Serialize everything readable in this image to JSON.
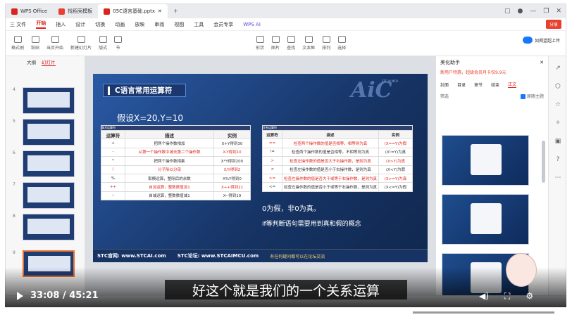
{
  "tabs": [
    {
      "label": "WPS Office",
      "color": "#d9241e"
    },
    {
      "label": "找稻壳模板",
      "color": "#e8402f"
    },
    {
      "label": "05C语言基础.pptx",
      "color": "#d9241e"
    }
  ],
  "menu": [
    "三 文件",
    "开始",
    "插入",
    "设计",
    "切换",
    "动画",
    "放映",
    "审阅",
    "视图",
    "工具",
    "会员专享",
    "WPS AI"
  ],
  "share_label": "分享",
  "ribbon": {
    "items": [
      "格式刷",
      "粘贴",
      "当页开始",
      "新建幻灯片",
      "版式",
      "节",
      "形状",
      "图片",
      "查找",
      "文本框",
      "排列",
      "选择"
    ],
    "upload_label": "如揭望超上传"
  },
  "left_panel": {
    "tabs": [
      "大纲",
      "幻灯片"
    ],
    "slide_numbers": [
      "4",
      "5",
      "6",
      "7",
      "8",
      "9"
    ]
  },
  "slide": {
    "title": "C语言常用运算符",
    "logo": "AiC",
    "logo_sub": "STC AI MCU",
    "assumption": "假设X=20,Y=10",
    "table1": {
      "caption": "算术运算符",
      "headers": [
        "运算符",
        "描述",
        "实例"
      ],
      "rows": [
        {
          "op": "+",
          "desc": "把两个操作数相加",
          "ex": "X+Y得到30",
          "red": false
        },
        {
          "op": "-",
          "desc": "从第一个操作数中减去第二个操作数",
          "ex": "X-Y得到10",
          "red": true
        },
        {
          "op": "*",
          "desc": "把两个操作数相乘",
          "ex": "X*Y得到200",
          "red": false
        },
        {
          "op": "/",
          "desc": "分子除以分母",
          "ex": "X/Y得到2",
          "red": true
        },
        {
          "op": "%",
          "desc": "取模运算，整除后的余数",
          "ex": "X%Y得到0",
          "red": false
        },
        {
          "op": "++",
          "desc": "自加运算，整数数值加1",
          "ex": "X++得到21",
          "red": true
        },
        {
          "op": "--",
          "desc": "自减运算，整数数值减1",
          "ex": "X--得到19",
          "red": false
        }
      ]
    },
    "table2": {
      "caption": "关系运算符",
      "headers": [
        "运算符",
        "描述",
        "实例"
      ],
      "rows": [
        {
          "op": "==",
          "desc": "检查两个操作数的值是否相等，相等则为真",
          "ex": "(X==Y)为假",
          "red": true
        },
        {
          "op": "!=",
          "desc": "检查两个操作数的值是否相等，不相等则为真",
          "ex": "(X!=Y)为真",
          "red": false
        },
        {
          "op": ">",
          "desc": "检查左操作数的值是否大于右操作数，是则为真",
          "ex": "(X>Y)为真",
          "red": true
        },
        {
          "op": "<",
          "desc": "检查左操作数的值是否小于右操作数，是则为真",
          "ex": "(X<Y)为假",
          "red": false
        },
        {
          "op": ">=",
          "desc": "检查左操作数的值是否大于或等于右操作数，是则为真",
          "ex": "(X>=Y)为真",
          "red": true
        },
        {
          "op": "<=",
          "desc": "检查左操作数的值是否小于或等于右操作数，是则为真",
          "ex": "(X<=Y)为假",
          "red": false
        }
      ]
    },
    "note1": "0为假，非0为真。",
    "note2": "if等判断语句需要用到真和假的概念",
    "footer": {
      "site": "STC官网: www.STCAI.com",
      "forum": "STC论坛: www.STCAIMCU.com",
      "question": "有任何疑问都可以在论坛交流"
    }
  },
  "right_panel": {
    "title": "美化助手",
    "promo": "新用户特惠，超级会员月卡仅9.9元",
    "tabs": [
      "封面",
      "目录",
      "章节",
      "结束",
      "正文"
    ],
    "filter_label": "筛选",
    "checkbox_label": "原随主题"
  },
  "video": {
    "subtitle": "好这个就是我们的一个关系运算",
    "current_time": "33:08",
    "duration": "45:21",
    "progress": 0.7306
  }
}
